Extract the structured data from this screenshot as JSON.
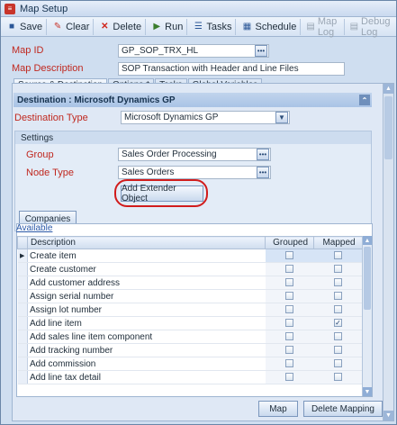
{
  "window": {
    "title": "Map Setup"
  },
  "toolbar": {
    "save": "Save",
    "clear": "Clear",
    "delete": "Delete",
    "run": "Run",
    "tasks": "Tasks",
    "schedule": "Schedule",
    "map_log": "Map Log",
    "debug_log": "Debug Log"
  },
  "fields": {
    "map_id_label": "Map ID",
    "map_id_value": "GP_SOP_TRX_HL",
    "map_desc_label": "Map Description",
    "map_desc_value": "SOP Transaction with Header and Line Files"
  },
  "tabs": [
    "Source & Destination",
    "Options *",
    "Tasks",
    "Global Variables"
  ],
  "destination": {
    "header": "Destination : Microsoft Dynamics GP",
    "type_label": "Destination Type",
    "type_value": "Microsoft Dynamics GP",
    "settings_title": "Settings",
    "group_label": "Group",
    "group_value": "Sales Order Processing",
    "node_label": "Node Type",
    "node_value": "Sales Orders",
    "extender_button": "Add Extender Object",
    "companies_button": "Companies"
  },
  "grid": {
    "available_label": "Available",
    "columns": [
      "Description",
      "Grouped",
      "Mapped"
    ],
    "rows": [
      {
        "desc": "Create item",
        "grouped": false,
        "mapped": false
      },
      {
        "desc": "Create customer",
        "grouped": false,
        "mapped": false
      },
      {
        "desc": "Add customer address",
        "grouped": false,
        "mapped": false
      },
      {
        "desc": "Assign serial number",
        "grouped": false,
        "mapped": false
      },
      {
        "desc": "Assign lot number",
        "grouped": false,
        "mapped": false
      },
      {
        "desc": "Add line item",
        "grouped": false,
        "mapped": true
      },
      {
        "desc": "Add sales line item component",
        "grouped": false,
        "mapped": false
      },
      {
        "desc": "Add tracking number",
        "grouped": false,
        "mapped": false
      },
      {
        "desc": "Add commission",
        "grouped": false,
        "mapped": false
      },
      {
        "desc": "Add line tax detail",
        "grouped": false,
        "mapped": false
      }
    ]
  },
  "buttons": {
    "map": "Map",
    "delete_mapping": "Delete Mapping"
  }
}
